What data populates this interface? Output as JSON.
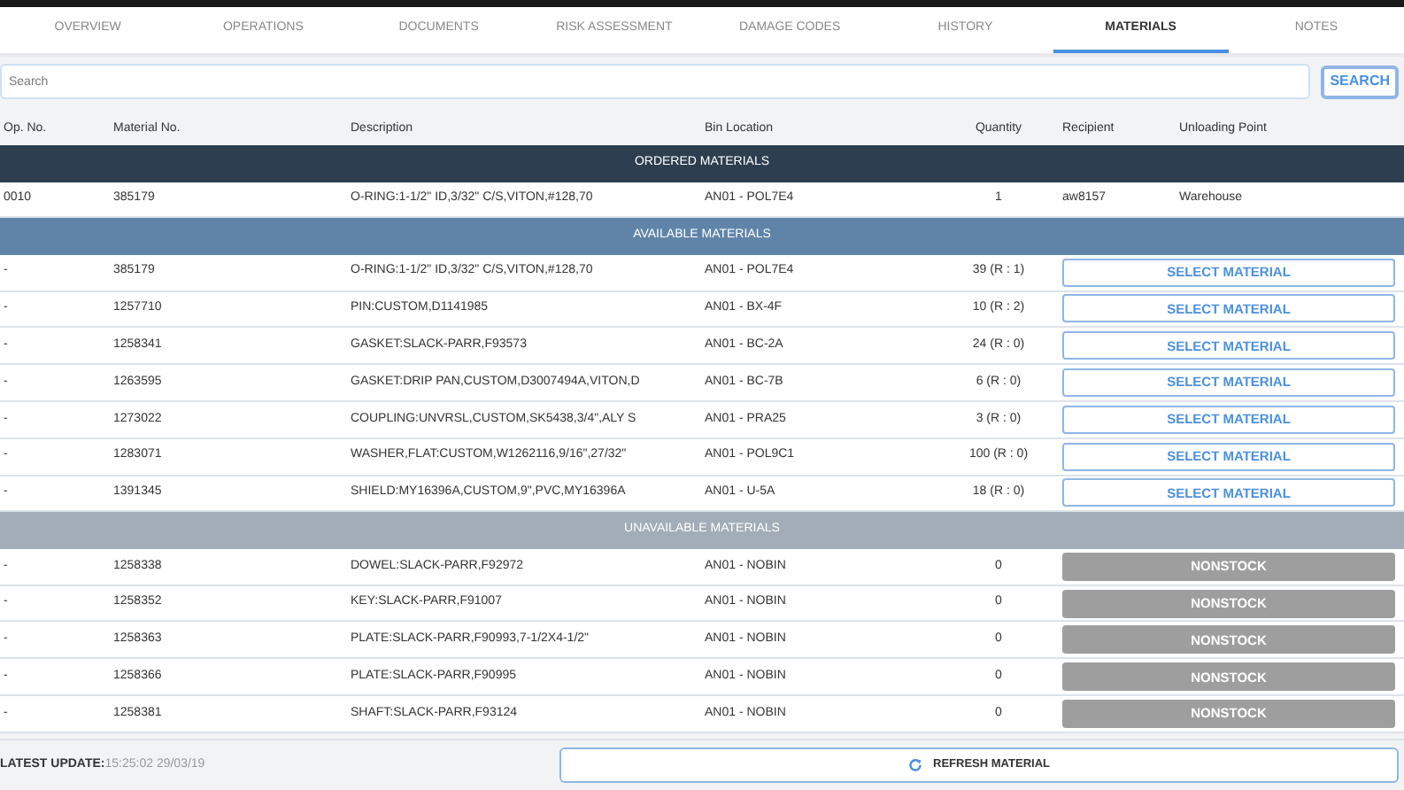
{
  "tabs": [
    {
      "label": "OVERVIEW",
      "selected": false
    },
    {
      "label": "OPERATIONS",
      "selected": false
    },
    {
      "label": "DOCUMENTS",
      "selected": false
    },
    {
      "label": "RISK ASSESSMENT",
      "selected": false
    },
    {
      "label": "DAMAGE CODES",
      "selected": false
    },
    {
      "label": "HISTORY",
      "selected": false
    },
    {
      "label": "MATERIALS",
      "selected": true
    },
    {
      "label": "NOTES",
      "selected": false
    }
  ],
  "search": {
    "placeholder": "Search",
    "button": "SEARCH"
  },
  "table": {
    "columns": [
      "Op. No.",
      "Material No.",
      "Description",
      "Bin Location",
      "Quantity",
      "Recipient",
      "Unloading Point"
    ],
    "sections": [
      {
        "title": "ORDERED MATERIALS",
        "kind": "ordered",
        "rows": [
          {
            "op_no": "0010",
            "material_no": "385179",
            "description": "O-RING:1-1/2\" ID,3/32\" C/S,VITON,#128,70",
            "bin_location": "AN01 - POL7E4",
            "quantity": "1",
            "recipient": "aw8157",
            "unloading_point": "Warehouse"
          }
        ]
      },
      {
        "title": "AVAILABLE MATERIALS",
        "kind": "available",
        "rows": [
          {
            "op_no": "-",
            "material_no": "385179",
            "description": "O-RING:1-1/2\" ID,3/32\" C/S,VITON,#128,70",
            "bin_location": "AN01 - POL7E4",
            "quantity": "39 (R : 1)",
            "action": "SELECT MATERIAL"
          },
          {
            "op_no": "-",
            "material_no": "1257710",
            "description": "PIN:CUSTOM,D1141985",
            "bin_location": "AN01 - BX-4F",
            "quantity": "10 (R : 2)",
            "action": "SELECT MATERIAL"
          },
          {
            "op_no": "-",
            "material_no": "1258341",
            "description": "GASKET:SLACK-PARR,F93573",
            "bin_location": "AN01 - BC-2A",
            "quantity": "24 (R : 0)",
            "action": "SELECT MATERIAL"
          },
          {
            "op_no": "-",
            "material_no": "1263595",
            "description": "GASKET:DRIP PAN,CUSTOM,D3007494A,VITON,D",
            "bin_location": "AN01 - BC-7B",
            "quantity": "6 (R : 0)",
            "action": "SELECT MATERIAL"
          },
          {
            "op_no": "-",
            "material_no": "1273022",
            "description": "COUPLING:UNVRSL,CUSTOM,SK5438,3/4\",ALY S",
            "bin_location": "AN01 - PRA25",
            "quantity": "3 (R : 0)",
            "action": "SELECT MATERIAL"
          },
          {
            "op_no": "-",
            "material_no": "1283071",
            "description": "WASHER,FLAT:CUSTOM,W1262116,9/16\",27/32\"",
            "bin_location": "AN01 - POL9C1",
            "quantity": "100 (R : 0)",
            "action": "SELECT MATERIAL"
          },
          {
            "op_no": "-",
            "material_no": "1391345",
            "description": "SHIELD:MY16396A,CUSTOM,9\",PVC,MY16396A",
            "bin_location": "AN01 - U-5A",
            "quantity": "18 (R : 0)",
            "action": "SELECT MATERIAL"
          }
        ]
      },
      {
        "title": "UNAVAILABLE MATERIALS",
        "kind": "unavailable",
        "rows": [
          {
            "op_no": "-",
            "material_no": "1258338",
            "description": "DOWEL:SLACK-PARR,F92972",
            "bin_location": "AN01 - NOBIN",
            "quantity": "0",
            "action": "NONSTOCK"
          },
          {
            "op_no": "-",
            "material_no": "1258352",
            "description": "KEY:SLACK-PARR,F91007",
            "bin_location": "AN01 - NOBIN",
            "quantity": "0",
            "action": "NONSTOCK"
          },
          {
            "op_no": "-",
            "material_no": "1258363",
            "description": "PLATE:SLACK-PARR,F90993,7-1/2X4-1/2\"",
            "bin_location": "AN01 - NOBIN",
            "quantity": "0",
            "action": "NONSTOCK"
          },
          {
            "op_no": "-",
            "material_no": "1258366",
            "description": "PLATE:SLACK-PARR,F90995",
            "bin_location": "AN01 - NOBIN",
            "quantity": "0",
            "action": "NONSTOCK"
          },
          {
            "op_no": "-",
            "material_no": "1258381",
            "description": "SHAFT:SLACK-PARR,F93124",
            "bin_location": "AN01 - NOBIN",
            "quantity": "0",
            "action": "NONSTOCK"
          }
        ]
      }
    ]
  },
  "footer": {
    "label": "LATEST UPDATE:",
    "value": "15:25:02 29/03/19",
    "button": "REFRESH MATERIAL"
  }
}
